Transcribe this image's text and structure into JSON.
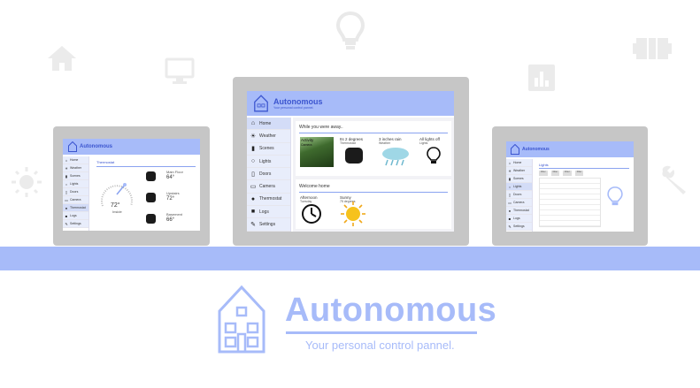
{
  "colors": {
    "accent": "#a7bbf9",
    "brand_text": "#3b55cf",
    "frame": "#c6c6c6"
  },
  "background_icons": [
    "home-icon",
    "monitor-icon",
    "lightbulb-icon",
    "chart-icon",
    "battery-icon",
    "sun-icon",
    "wrench-icon"
  ],
  "app": {
    "name": "Autonomous",
    "tagline": "Your personal control pannel."
  },
  "nav": [
    "Home",
    "Weather",
    "Scenes",
    "Lights",
    "Doors",
    "Camera",
    "Thermostat",
    "Logs",
    "Settings"
  ],
  "center": {
    "away_title": "While you were away..",
    "away_items": [
      {
        "label": "Activity",
        "sub": "Camera"
      },
      {
        "label": "Its 2 degrees",
        "sub": "Thermostat"
      },
      {
        "label": "3 inches rain",
        "sub": "Weather"
      },
      {
        "label": "All lights off",
        "sub": "Lights"
      }
    ],
    "welcome_title": "Welcome home",
    "welcome_items": [
      {
        "label": "Afternoon",
        "sub": "Tuesday"
      },
      {
        "label": "Sunny",
        "sub": "75 degrees"
      }
    ]
  },
  "left": {
    "title": "Thermostat",
    "gauge_value": "72°",
    "gauge_label": "Inside",
    "rooms": [
      {
        "name": "Main Floor",
        "temp": "64°"
      },
      {
        "name": "Upstairs",
        "temp": "72°"
      },
      {
        "name": "Basement",
        "temp": "66°"
      }
    ]
  },
  "right": {
    "title": "Lights",
    "filters": [
      "Filter",
      "Filter",
      "Filter",
      "Filter"
    ]
  }
}
